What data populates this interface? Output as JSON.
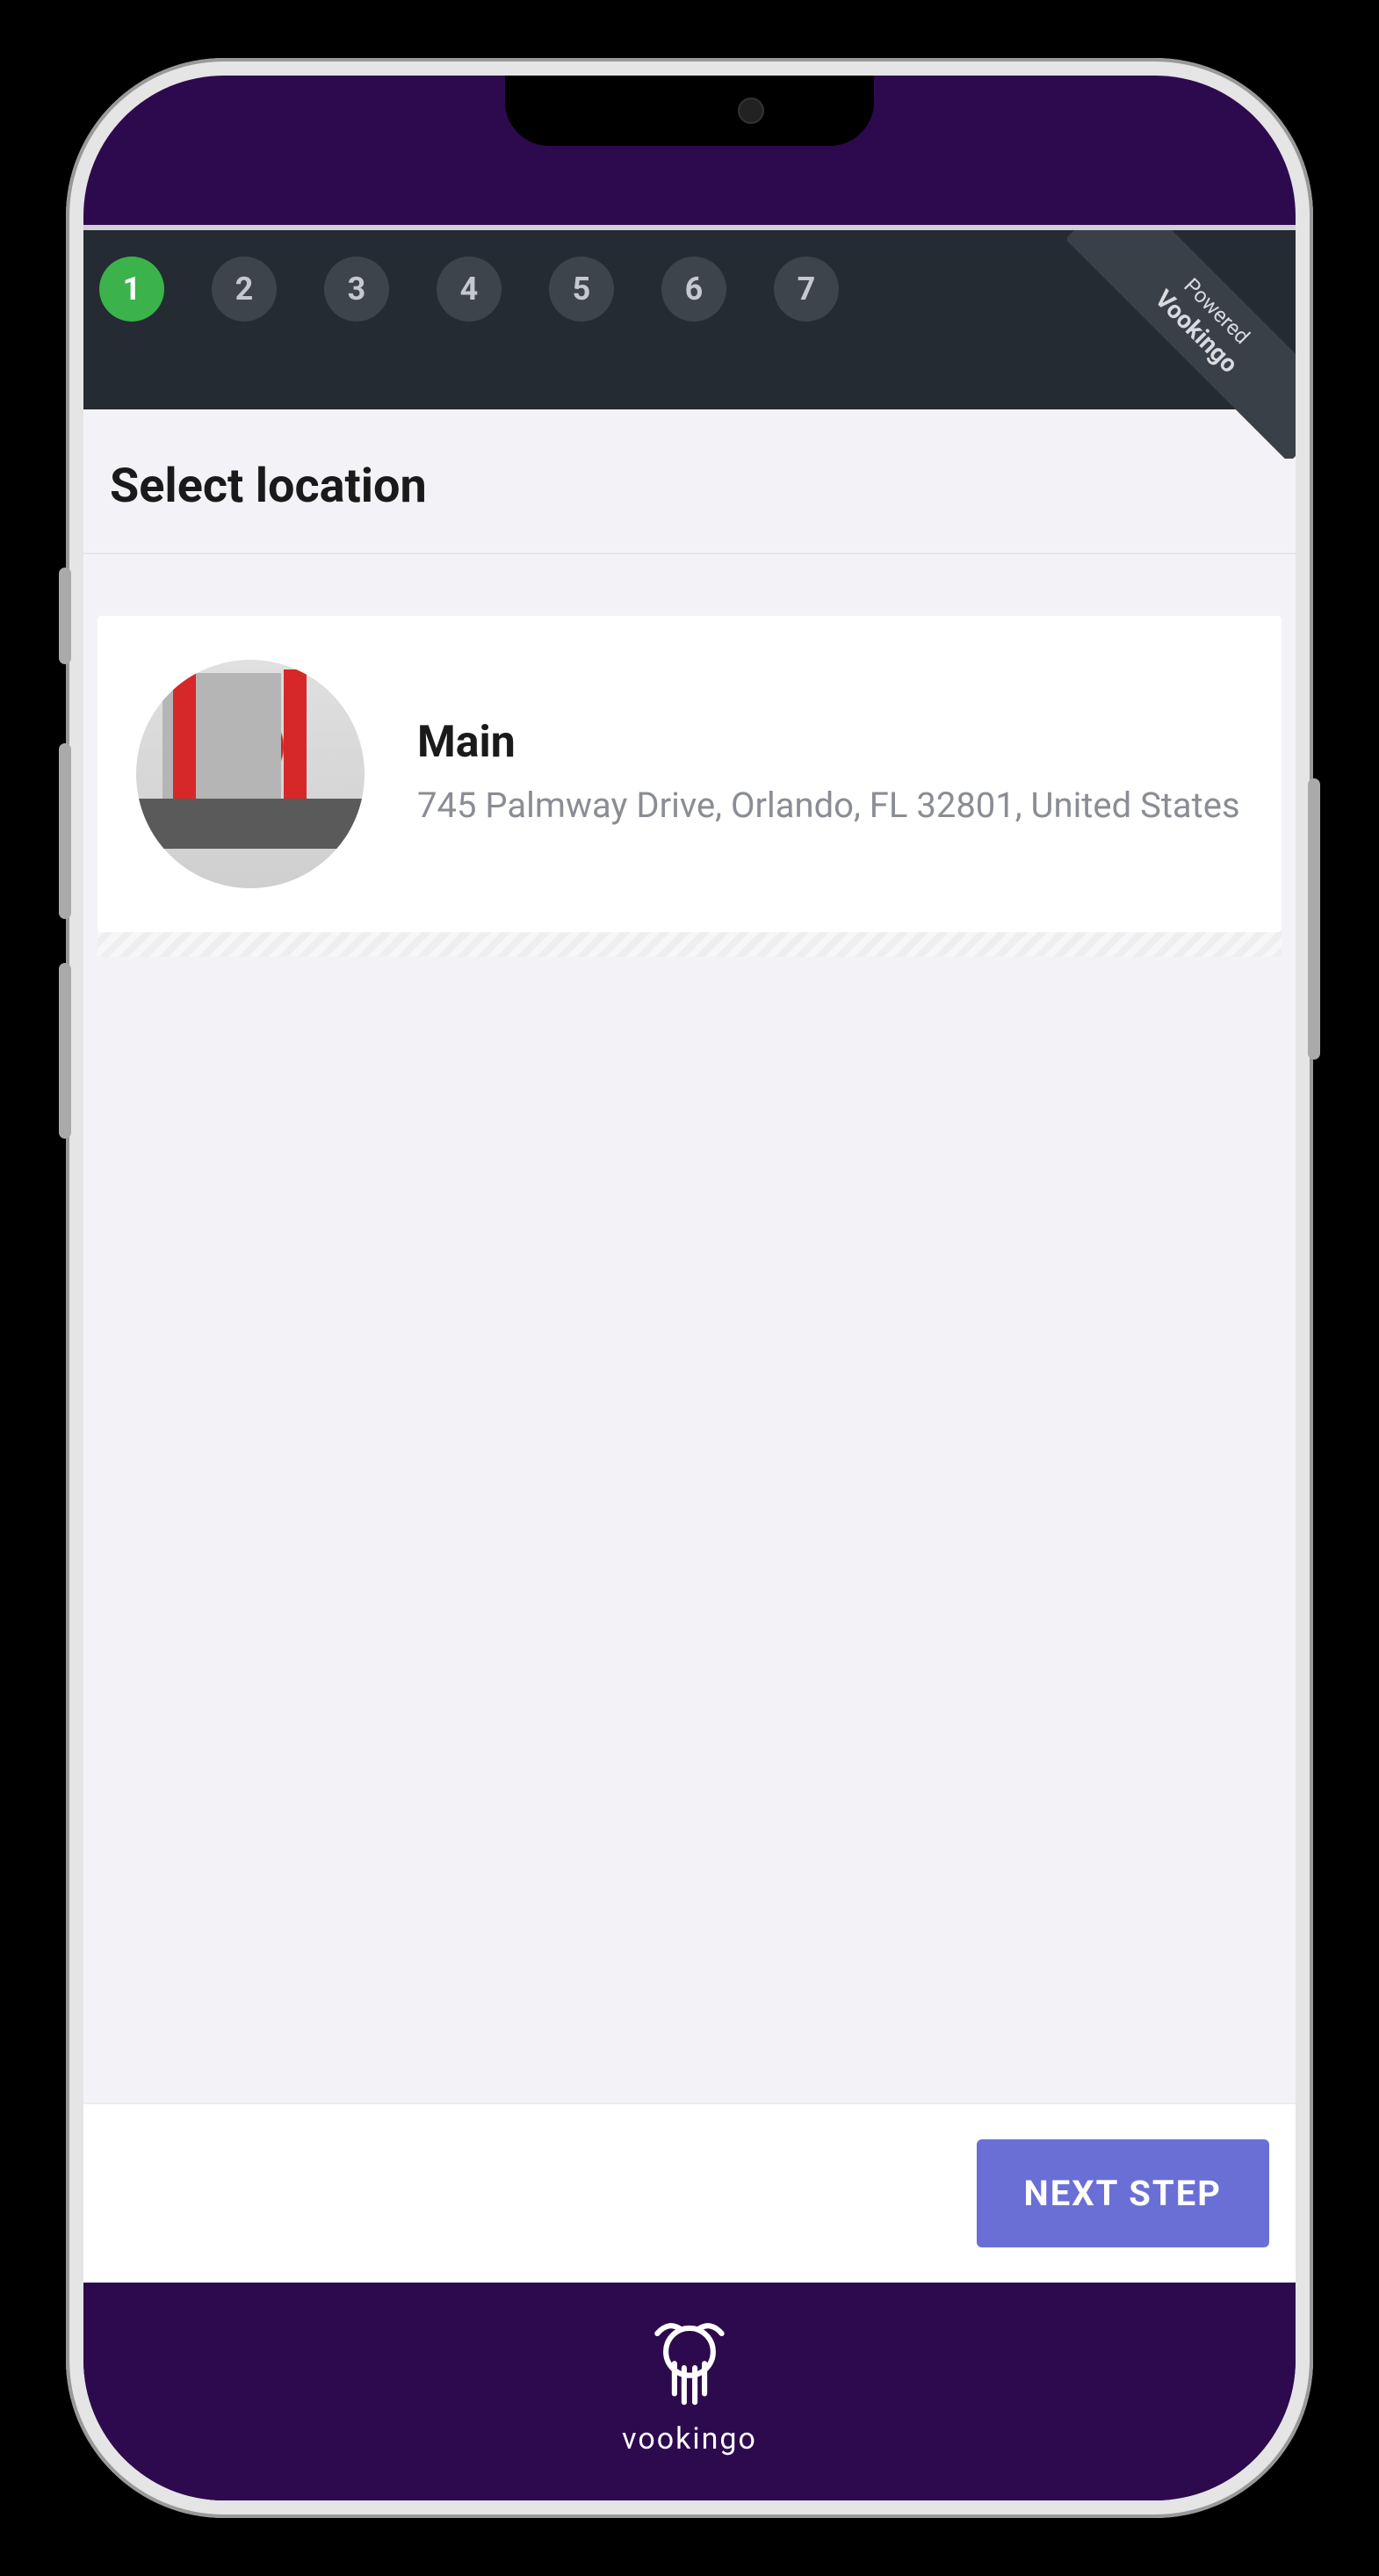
{
  "stepper": {
    "steps": [
      "1",
      "2",
      "3",
      "4",
      "5",
      "6",
      "7"
    ],
    "active_index": 0
  },
  "ribbon": {
    "prefix": "Powered",
    "brand": "Vookingo"
  },
  "page": {
    "title": "Select location"
  },
  "locations": [
    {
      "name": "Main",
      "address": "745 Palmway Drive, Orlando, FL 32801, United States"
    }
  ],
  "footer": {
    "next_label": "NEXT STEP"
  },
  "brand": {
    "name": "vookingo"
  }
}
